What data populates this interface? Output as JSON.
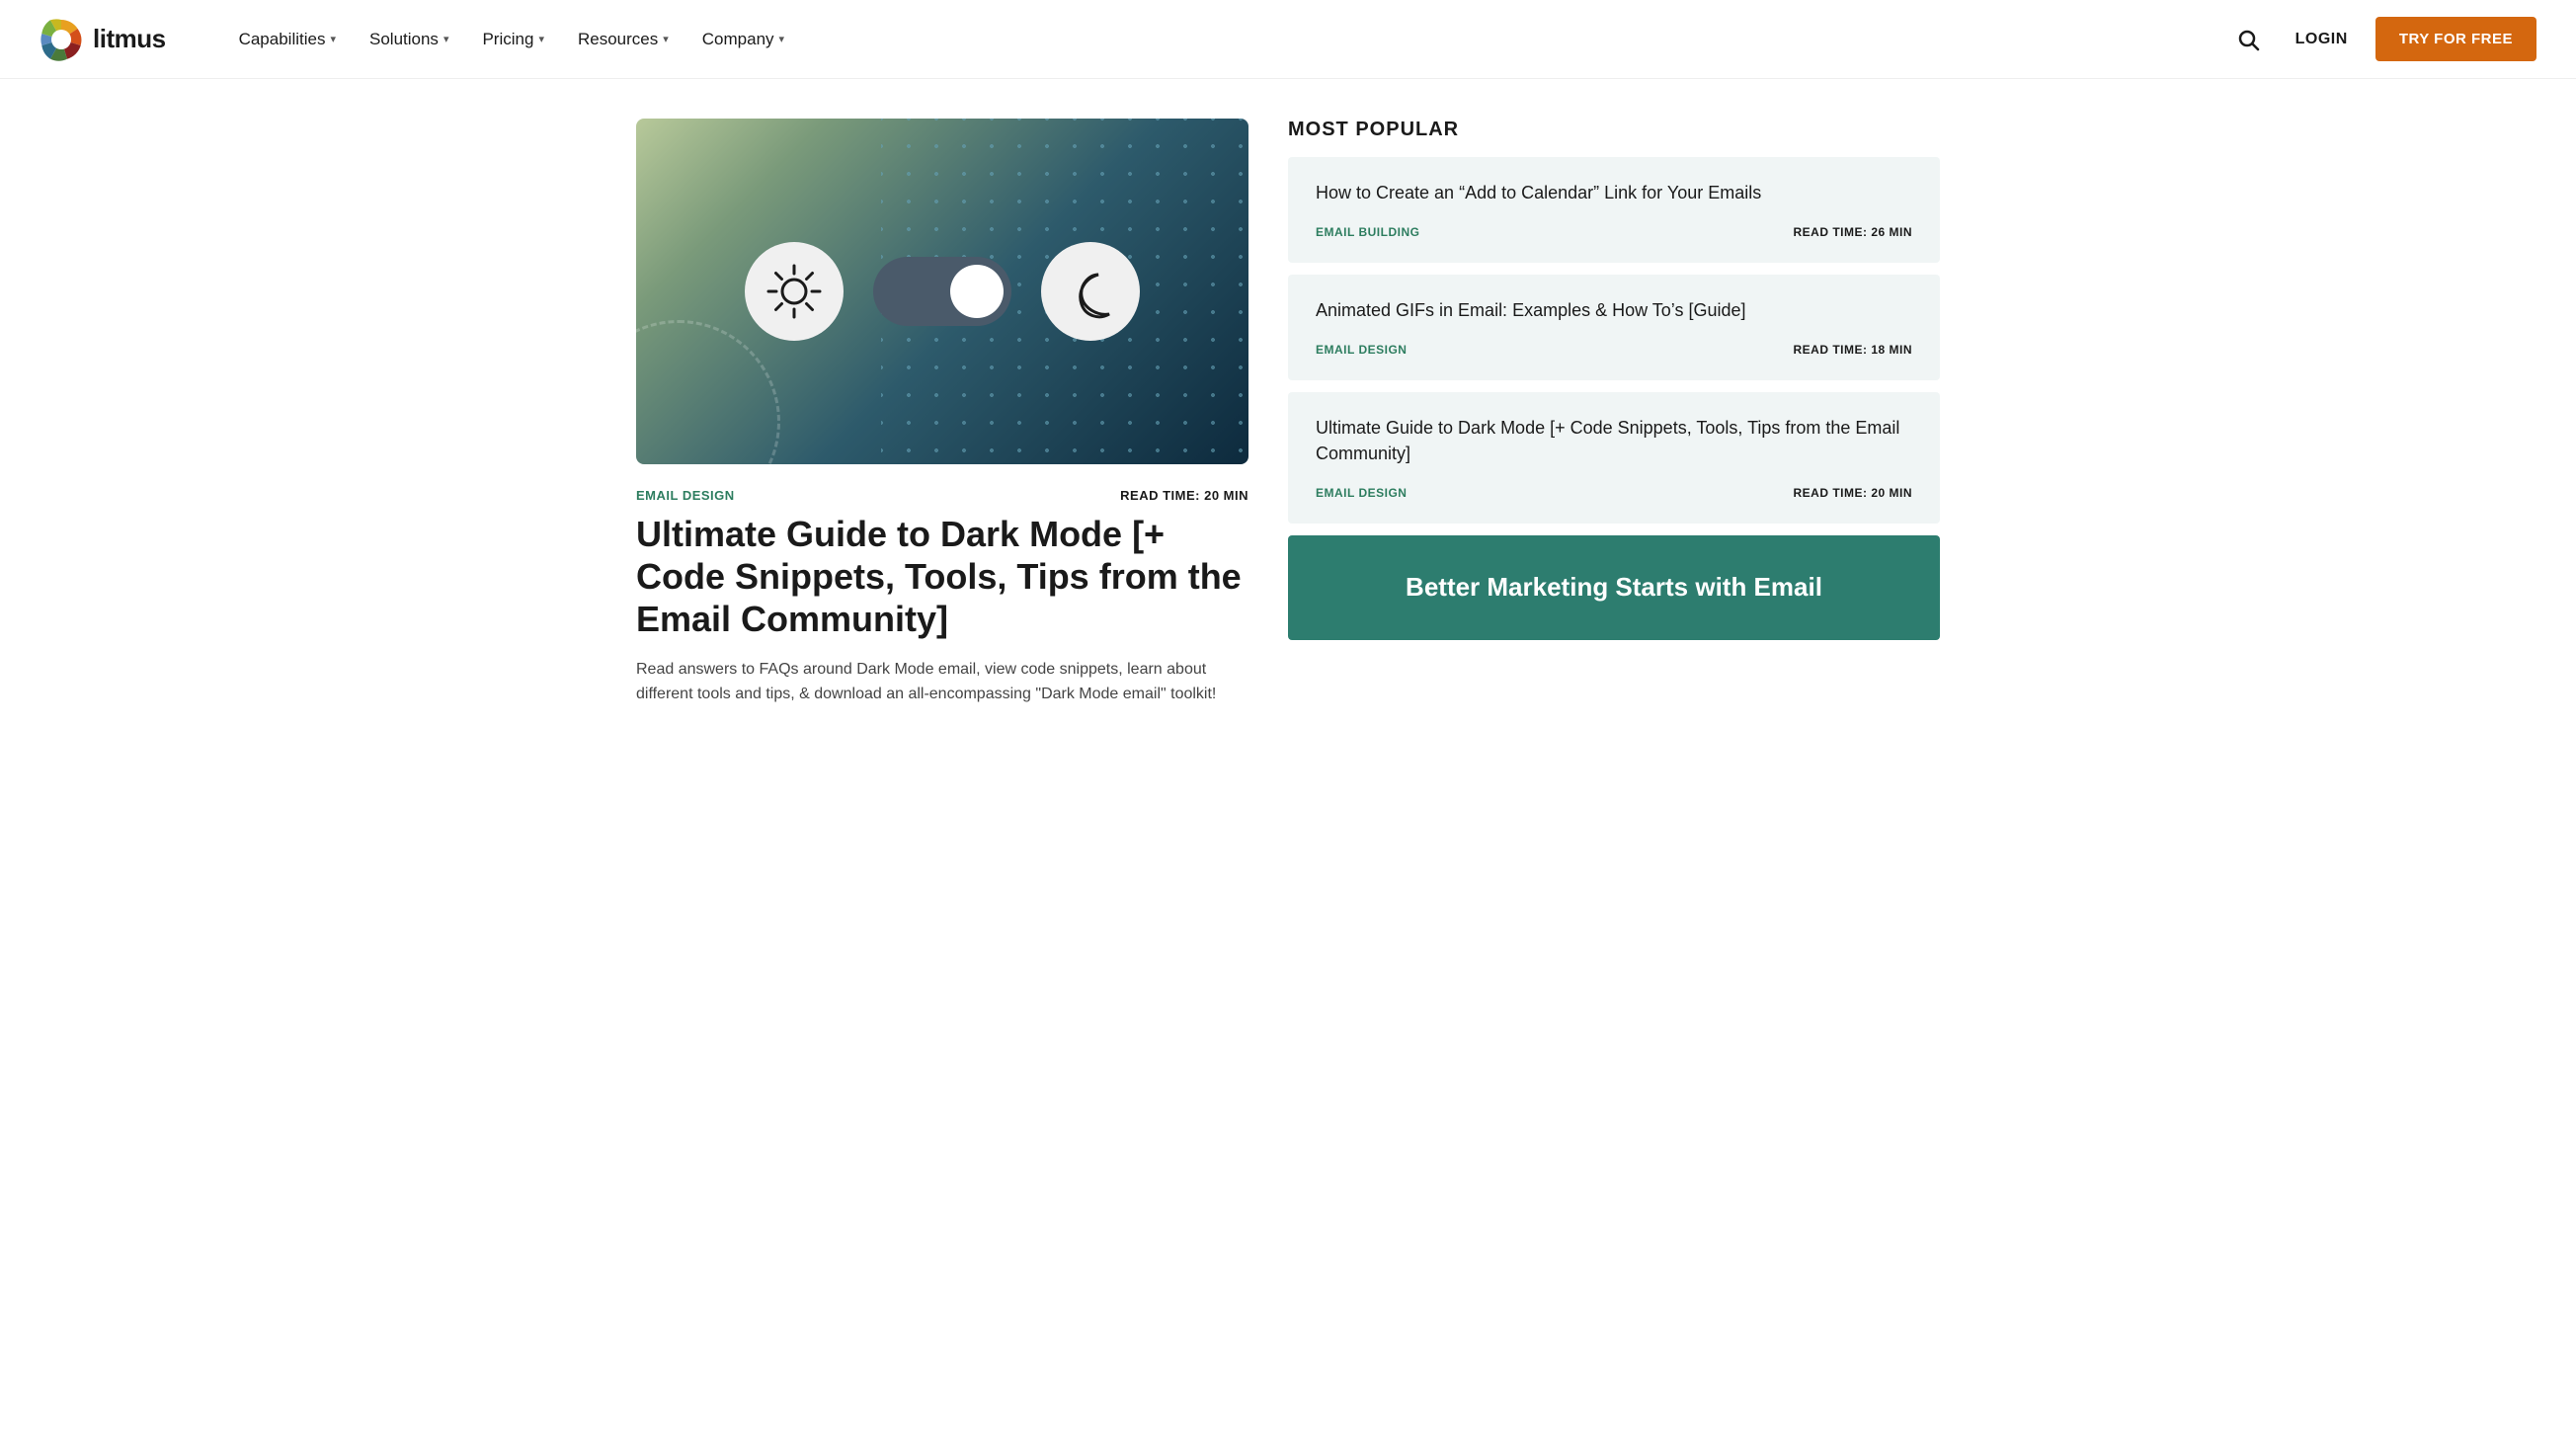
{
  "nav": {
    "logo_text": "litmus",
    "items": [
      {
        "label": "Capabilities",
        "has_dropdown": true
      },
      {
        "label": "Solutions",
        "has_dropdown": true
      },
      {
        "label": "Pricing",
        "has_dropdown": true
      },
      {
        "label": "Resources",
        "has_dropdown": true
      },
      {
        "label": "Company",
        "has_dropdown": true
      }
    ],
    "login_label": "LOGIN",
    "try_free_label": "TRY FOR FREE"
  },
  "article": {
    "tag": "EMAIL DESIGN",
    "read_time": "READ TIME: 20 MIN",
    "title": "Ultimate Guide to Dark Mode [+ Code Snippets, Tools, Tips from the Email Community]",
    "description": "Read answers to FAQs around Dark Mode email, view code snippets, learn about different tools and tips, & download an all-encompassing \"Dark Mode email\" toolkit!"
  },
  "sidebar": {
    "most_popular_label": "MOST POPULAR",
    "cards": [
      {
        "title": "How to Create an “Add to Calendar” Link for Your Emails",
        "tag": "EMAIL BUILDING",
        "read_time": "READ TIME: 26 MIN"
      },
      {
        "title": "Animated GIFs in Email: Examples & How To’s [Guide]",
        "tag": "EMAIL DESIGN",
        "read_time": "READ TIME: 18 MIN"
      },
      {
        "title": "Ultimate Guide to Dark Mode [+ Code Snippets, Tools, Tips from the Email Community]",
        "tag": "EMAIL DESIGN",
        "read_time": "READ TIME: 20 MIN"
      }
    ],
    "cta_title": "Better Marketing Starts with Email"
  }
}
